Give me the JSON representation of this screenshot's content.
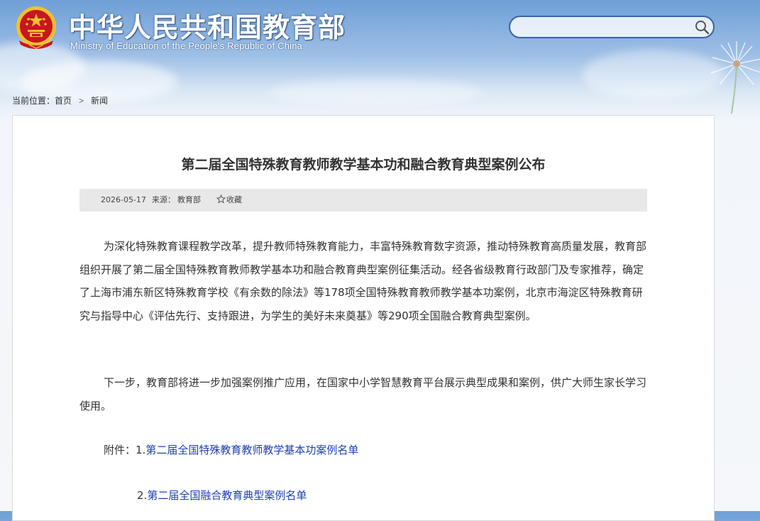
{
  "header": {
    "title": "中华人民共和国教育部",
    "subtitle": "Ministry of Education of the People's Republic of China",
    "search_placeholder": ""
  },
  "breadcrumb": {
    "prefix": "当前位置：",
    "home": "首页",
    "separator": ">",
    "current": "新闻"
  },
  "article": {
    "title": "第二届全国特殊教育教师教学基本功和融合教育典型案例公布",
    "date": "2026-05-17",
    "source_label": "来源：",
    "source": "教育部",
    "favorite_label": "收藏",
    "paragraphs": [
      "为深化特殊教育课程教学改革，提升教师特殊教育能力，丰富特殊教育数字资源，推动特殊教育高质量发展，教育部组织开展了第二届全国特殊教育教师教学基本功和融合教育典型案例征集活动。经各省级教育行政部门及专家推荐，确定了上海市浦东新区特殊教育学校《有余数的除法》等178项全国特殊教育教师教学基本功案例，北京市海淀区特殊教育研究与指导中心《评估先行、支持跟进，为学生的美好未来奠基》等290项全国融合教育典型案例。",
      "下一步，教育部将进一步加强案例推广应用，在国家中小学智慧教育平台展示典型成果和案例，供广大师生家长学习使用。"
    ],
    "attachments_label": "附件：",
    "attachments": [
      {
        "number": "1.",
        "title": "第二届全国特殊教育教师教学基本功案例名单"
      },
      {
        "number": "2.",
        "title": "第二届全国融合教育典型案例名单"
      }
    ]
  },
  "colors": {
    "header_sky": "#6f9fd6",
    "search_border": "#3a63a8",
    "link": "#1d3fb2",
    "emblem_red": "#c8161d",
    "emblem_gold": "#f2c12e"
  }
}
